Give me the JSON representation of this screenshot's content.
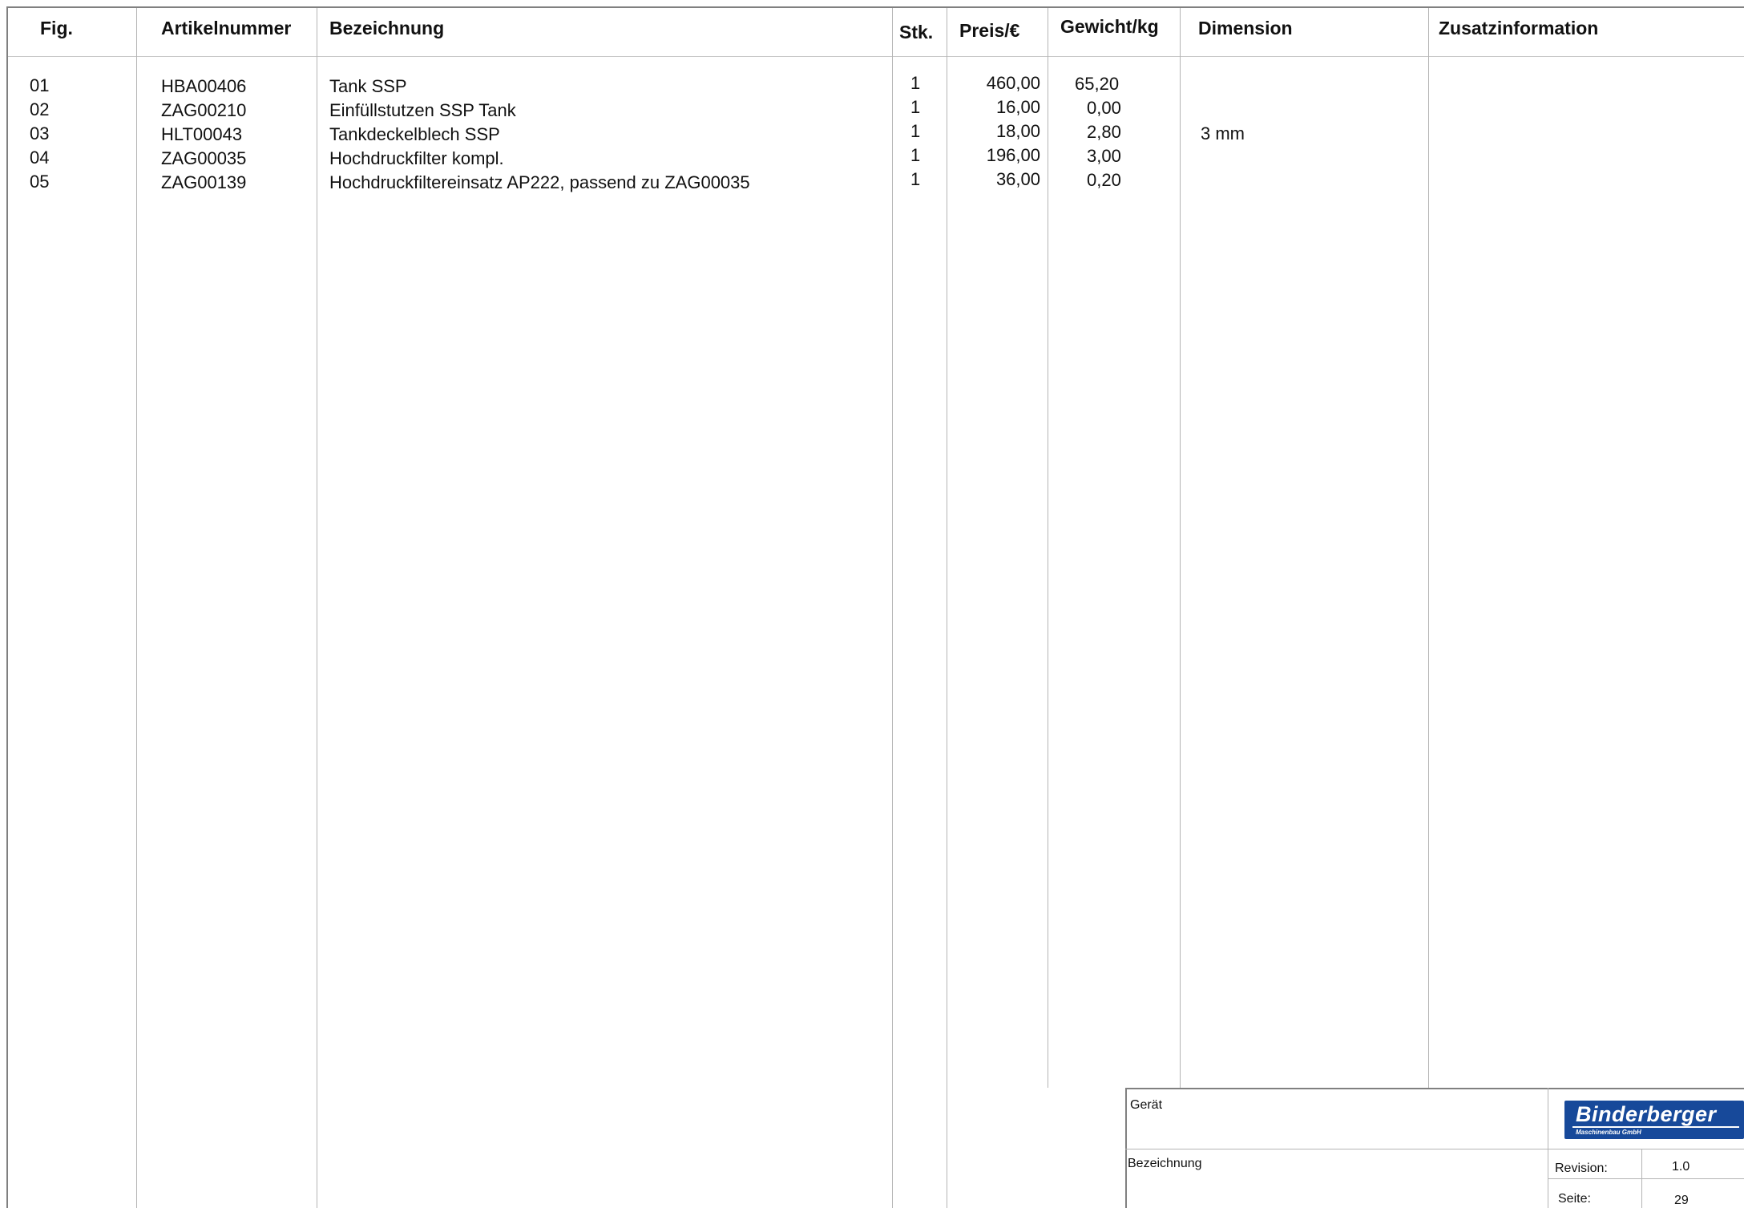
{
  "table": {
    "headers": {
      "fig": "Fig.",
      "artikelnummer": "Artikelnummer",
      "bezeichnung": "Bezeichnung",
      "stk": "Stk.",
      "preis": "Preis/€",
      "gewicht": "Gewicht/kg",
      "dimension": "Dimension",
      "zusatz": "Zusatzinformation"
    },
    "rows": [
      {
        "fig": "01",
        "artikelnummer": "HBA00406",
        "bezeichnung": "Tank SSP",
        "stk": "1",
        "preis": "460,00",
        "gewicht": "65,20",
        "dimension": "",
        "zusatz": ""
      },
      {
        "fig": "02",
        "artikelnummer": "ZAG00210",
        "bezeichnung": "Einfüllstutzen SSP Tank",
        "stk": "1",
        "preis": "16,00",
        "gewicht": "0,00",
        "dimension": "",
        "zusatz": ""
      },
      {
        "fig": "03",
        "artikelnummer": "HLT00043",
        "bezeichnung": "Tankdeckelblech SSP",
        "stk": "1",
        "preis": "18,00",
        "gewicht": "2,80",
        "dimension": "3 mm",
        "zusatz": ""
      },
      {
        "fig": "04",
        "artikelnummer": "ZAG00035",
        "bezeichnung": "Hochdruckfilter kompl.",
        "stk": "1",
        "preis": "196,00",
        "gewicht": "3,00",
        "dimension": "",
        "zusatz": ""
      },
      {
        "fig": "05",
        "artikelnummer": "ZAG00139",
        "bezeichnung": "Hochdruckfiltereinsatz AP222, passend zu ZAG00035",
        "stk": "1",
        "preis": "36,00",
        "gewicht": "0,20",
        "dimension": "",
        "zusatz": ""
      }
    ]
  },
  "title_block": {
    "geraet_label": "Gerät",
    "bezeichnung_label": "Bezeichnung",
    "revision_label": "Revision:",
    "revision_value": "1.0",
    "seite_label": "Seite:",
    "seite_value": "29",
    "logo_name": "Binderberger",
    "logo_sub": "Maschinenbau GmbH"
  }
}
